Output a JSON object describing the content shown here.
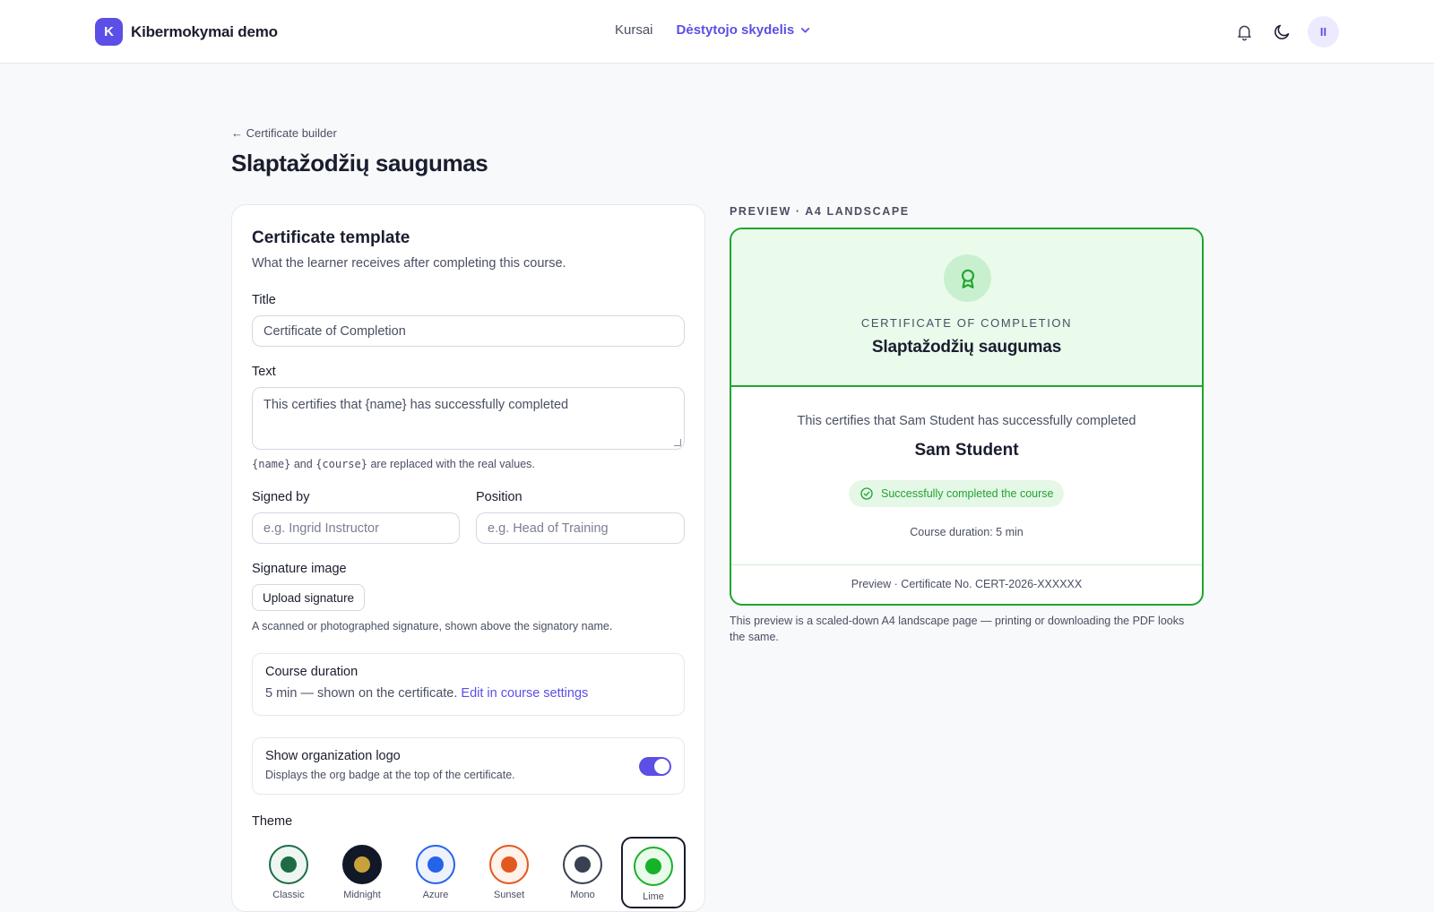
{
  "header": {
    "brand_initial": "K",
    "brand_name": "Kibermokymai demo",
    "nav": {
      "courses": "Kursai",
      "instructor_panel": "Dėstytojo skydelis"
    },
    "avatar_initials": "II"
  },
  "breadcrumb": "← Certificate builder",
  "page_title": "Slaptažodžių saugumas",
  "form": {
    "heading": "Certificate template",
    "subheading": "What the learner receives after completing this course.",
    "title_label": "Title",
    "title_value": "Certificate of Completion",
    "text_label": "Text",
    "text_value": "This certifies that {name} has successfully completed",
    "text_hint_name": "{name}",
    "text_hint_and": "and",
    "text_hint_course": "{course}",
    "text_hint_rest": "are replaced with the real values.",
    "signed_by_label": "Signed by",
    "signed_by_placeholder": "e.g. Ingrid Instructor",
    "position_label": "Position",
    "position_placeholder": "e.g. Head of Training",
    "signature_label": "Signature image",
    "upload_button": "Upload signature",
    "signature_hint": "A scanned or photographed signature, shown above the signatory name.",
    "duration_title": "Course duration",
    "duration_text": "5 min — shown on the certificate.",
    "duration_link": "Edit in course settings",
    "logo_title": "Show organization logo",
    "logo_desc": "Displays the org badge at the top of the certificate.",
    "logo_enabled": true,
    "theme_label": "Theme",
    "themes": [
      {
        "name": "Classic",
        "ring": "#1e6b47",
        "fill": "#1e6b47",
        "bg": "#eef6f1"
      },
      {
        "name": "Midnight",
        "ring": "#111827",
        "fill": "#c8a13a",
        "bg": "#111827"
      },
      {
        "name": "Azure",
        "ring": "#2563eb",
        "fill": "#2563eb",
        "bg": "#eef2ff"
      },
      {
        "name": "Sunset",
        "ring": "#e2581f",
        "fill": "#e2581f",
        "bg": "#fff3ec"
      },
      {
        "name": "Mono",
        "ring": "#374151",
        "fill": "#374151",
        "bg": "#ffffff"
      },
      {
        "name": "Lime",
        "ring": "#16b22a",
        "fill": "#16b22a",
        "bg": "#eafbec"
      }
    ],
    "selected_theme": "Lime"
  },
  "preview": {
    "label": "PREVIEW · A4 LANDSCAPE",
    "kicker": "CERTIFICATE OF COMPLETION",
    "course": "Slaptažodžių saugumas",
    "text": "This certifies that Sam Student has successfully completed",
    "name": "Sam Student",
    "status": "Successfully completed the course",
    "duration": "Course duration: 5 min",
    "footer": "Preview · Certificate No. CERT-2026-XXXXXX",
    "note": "This preview is a scaled-down A4 landscape page — printing or downloading the PDF looks the same.",
    "accent": "#1fa52e"
  }
}
